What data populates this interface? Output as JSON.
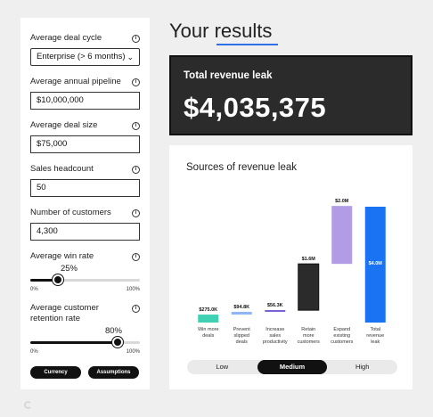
{
  "inputs": {
    "deal_cycle": {
      "label": "Average deal cycle",
      "value": "Enterprise (> 6 months)"
    },
    "pipeline": {
      "label": "Average annual pipeline",
      "value": "$10,000,000"
    },
    "deal_size": {
      "label": "Average deal size",
      "value": "$75,000"
    },
    "headcount": {
      "label": "Sales headcount",
      "value": "50"
    },
    "customers": {
      "label": "Number of customers",
      "value": "4,300"
    },
    "win_rate": {
      "label": "Average win rate",
      "value": "25%",
      "fraction": 0.25,
      "min_label": "0%",
      "max_label": "100%"
    },
    "retention": {
      "label": "Average customer retention rate",
      "value": "80%",
      "fraction": 0.8,
      "min_label": "0%",
      "max_label": "100%"
    }
  },
  "buttons": {
    "currency": "Currency",
    "assumptions": "Assumptions"
  },
  "results": {
    "title_prefix": "Your ",
    "title_highlight": "results"
  },
  "leak": {
    "label": "Total revenue leak",
    "value": "$4,035,375"
  },
  "toggle": {
    "options": [
      "Low",
      "Medium",
      "High"
    ],
    "selected": "Medium"
  },
  "colors": {
    "accent": "#2f6fe8",
    "teal": "#3fd1b3",
    "blue_light": "#8fb6f5",
    "purple": "#7a5fd6",
    "dark": "#2b2b2b",
    "lavender": "#b39ce6",
    "blue": "#1a73f2"
  },
  "chart_data": {
    "type": "bar",
    "title": "Sources of revenue leak",
    "categories": [
      "Win more deals",
      "Prevent slipped deals",
      "Increase sales productivity",
      "Retain more customers",
      "Expand existing customers",
      "Total revenue leak"
    ],
    "category_lines": [
      [
        "Win more",
        "deals"
      ],
      [
        "Prevent",
        "slipped",
        "deals"
      ],
      [
        "Increase",
        "sales",
        "productivity"
      ],
      [
        "Retain",
        "more",
        "customers"
      ],
      [
        "Expand",
        "existing",
        "customers"
      ],
      [
        "Total",
        "revenue",
        "leak"
      ]
    ],
    "values": [
      275000,
      94800,
      56300,
      1600000,
      2000000,
      4000000
    ],
    "labels": [
      "$275.0K",
      "$94.8K",
      "$56.3K",
      "$1.6M",
      "$2.0M",
      "$4.0M"
    ],
    "style": "waterfall",
    "colors": [
      "#3fd1b3",
      "#8fb6f5",
      "#7a5fd6",
      "#2b2b2b",
      "#b39ce6",
      "#1a73f2"
    ]
  }
}
